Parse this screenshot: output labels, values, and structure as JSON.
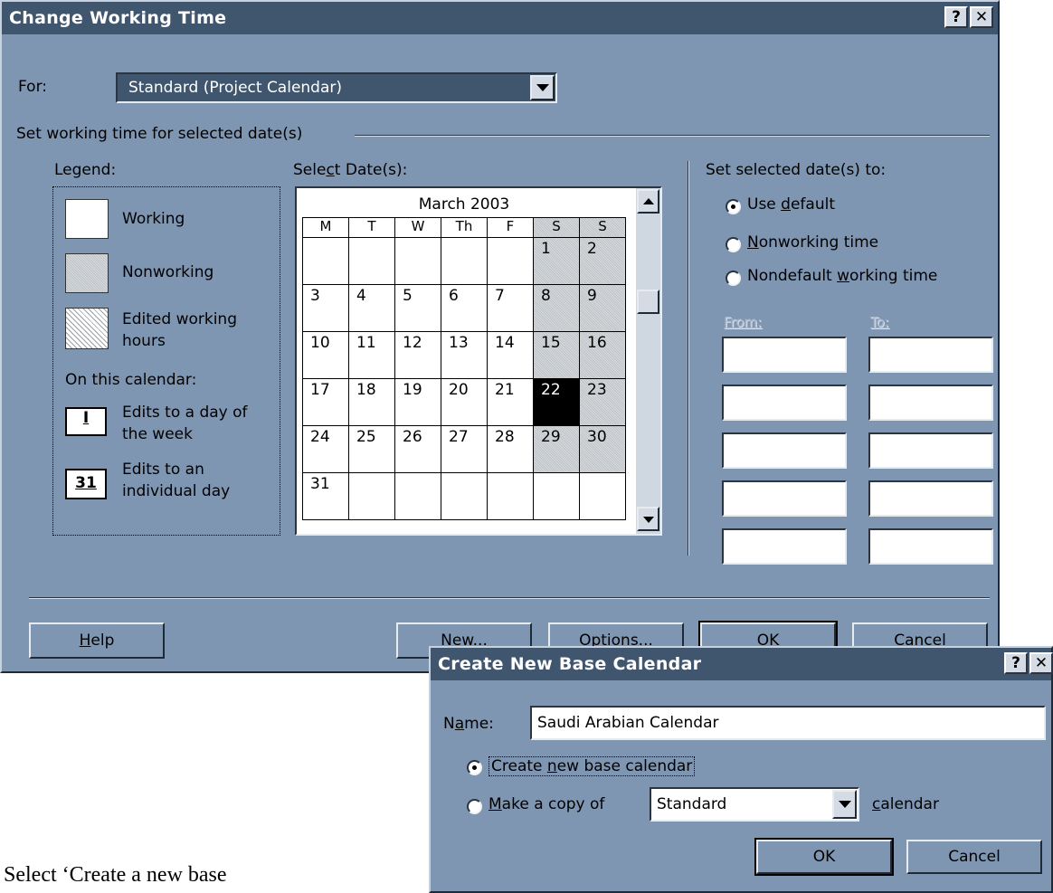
{
  "main_dialog": {
    "title": "Change Working Time",
    "help_glyph": "?",
    "close_glyph": "✕",
    "for_label": "For:",
    "for_value": "Standard (Project Calendar)",
    "group_label": "Set working time for selected date(s)",
    "legend": {
      "title": "Legend:",
      "working": "Working",
      "nonworking": "Nonworking",
      "edited_line1": "Edited working",
      "edited_line2": "hours",
      "on_calendar": "On this calendar:",
      "dow_icon_text": "I",
      "dow_line1": "Edits to a day of",
      "dow_line2": "the week",
      "day_icon_text": "31",
      "day_line1": "Edits to an",
      "day_line2": "individual day"
    },
    "select_dates_label": "Select Date(s):",
    "calendar": {
      "month_title": "March 2003",
      "day_headers": [
        "M",
        "T",
        "W",
        "Th",
        "F",
        "S",
        "S"
      ],
      "weeks": [
        [
          "",
          "",
          "",
          "",
          "",
          "1",
          "2"
        ],
        [
          "3",
          "4",
          "5",
          "6",
          "7",
          "8",
          "9"
        ],
        [
          "10",
          "11",
          "12",
          "13",
          "14",
          "15",
          "16"
        ],
        [
          "17",
          "18",
          "19",
          "20",
          "21",
          "22",
          "23"
        ],
        [
          "24",
          "25",
          "26",
          "27",
          "28",
          "29",
          "30"
        ],
        [
          "31",
          "",
          "",
          "",
          "",
          "",
          ""
        ]
      ],
      "selected_day": "22"
    },
    "set_to": {
      "label": "Set selected date(s) to:",
      "options": [
        "Use default",
        "Nonworking time",
        "Nondefault working time"
      ],
      "selected_index": 0,
      "from_label": "From:",
      "to_label": "To:"
    },
    "buttons": {
      "help": "Help",
      "new": "New...",
      "options": "Options...",
      "ok": "OK",
      "cancel": "Cancel"
    }
  },
  "new_dialog": {
    "title": "Create New Base Calendar",
    "name_label": "Name:",
    "name_value": "Saudi Arabian Calendar",
    "create_new": "Create new base calendar",
    "make_copy": "Make a copy of",
    "copy_source": "Standard",
    "calendar_word": "calendar",
    "ok": "OK",
    "cancel": "Cancel"
  },
  "caption": "Select ‘Create a new base"
}
